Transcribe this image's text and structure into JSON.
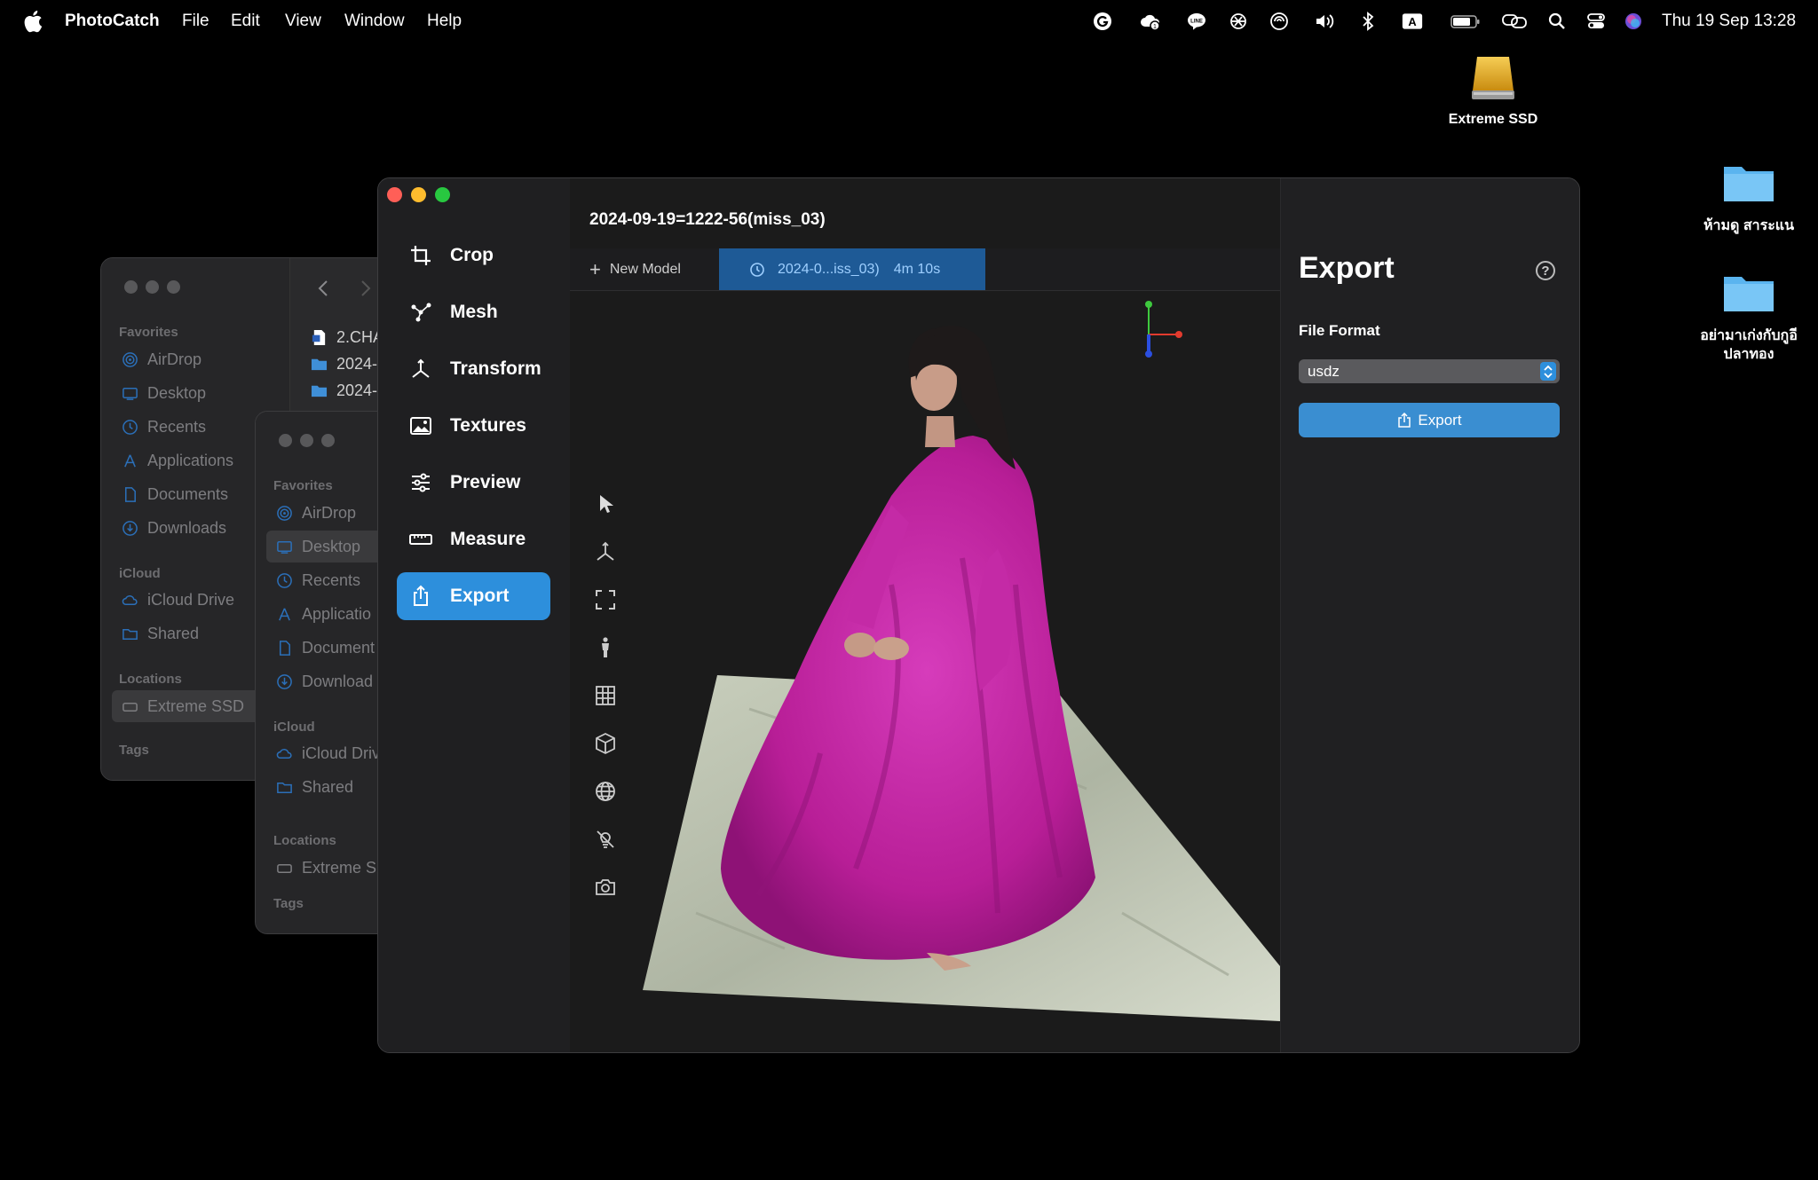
{
  "menubar": {
    "app_name": "PhotoCatch",
    "menus": [
      "File",
      "Edit",
      "View",
      "Window",
      "Help"
    ],
    "clock": "Thu 19 Sep  13:28",
    "input_source": "A"
  },
  "desktop": {
    "drive_label": "Extreme SSD",
    "folders": [
      {
        "label_lines": [
          "ห้ามดู สาระแน"
        ]
      },
      {
        "label_lines": [
          "อย่ามาเก่งกับกูอี",
          "ปลาทอง"
        ]
      }
    ]
  },
  "finder_back": {
    "favorites_header": "Favorites",
    "favorites": [
      "AirDrop",
      "Desktop",
      "Recents",
      "Applications",
      "Documents",
      "Downloads"
    ],
    "icloud_header": "iCloud",
    "icloud": [
      "iCloud Drive",
      "Shared"
    ],
    "locations_header": "Locations",
    "locations": [
      "Extreme SSD"
    ],
    "tags_header": "Tags",
    "files": [
      "2.CHA",
      "2024-",
      "2024-"
    ]
  },
  "finder_front": {
    "favorites_header": "Favorites",
    "favorites": [
      "AirDrop",
      "Desktop",
      "Recents",
      "Applicatio",
      "Document",
      "Download"
    ],
    "icloud_header": "iCloud",
    "icloud": [
      "iCloud Driv",
      "Shared"
    ],
    "locations_header": "Locations",
    "locations": [
      "Extreme S"
    ],
    "tags_header": "Tags"
  },
  "photocatch": {
    "document_title": "2024-09-19=1222-56(miss_03)",
    "nav": [
      {
        "label": "Crop",
        "icon": "crop-icon"
      },
      {
        "label": "Mesh",
        "icon": "mesh-icon"
      },
      {
        "label": "Transform",
        "icon": "transform-icon"
      },
      {
        "label": "Textures",
        "icon": "textures-icon"
      },
      {
        "label": "Preview",
        "icon": "preview-sliders-icon"
      },
      {
        "label": "Measure",
        "icon": "ruler-icon"
      },
      {
        "label": "Export",
        "icon": "share-icon",
        "active": true
      }
    ],
    "tabs": {
      "new_model": "New Model",
      "model_name": "2024-0...iss_03)",
      "model_duration": "4m 10s"
    },
    "tools": [
      "pointer-icon",
      "axes-icon",
      "frame-icon",
      "figure-icon",
      "grid-icon",
      "cube-icon",
      "globe-icon",
      "light-off-icon",
      "camera-icon"
    ],
    "export_panel": {
      "title": "Export",
      "help": "?",
      "file_format_label": "File Format",
      "file_format_value": "usdz",
      "export_button": "Export"
    },
    "colors": {
      "accent": "#2d8fdc",
      "tab_selected": "#1e5a96",
      "dress": "#c2249f",
      "mat": "#b8bfae"
    }
  }
}
